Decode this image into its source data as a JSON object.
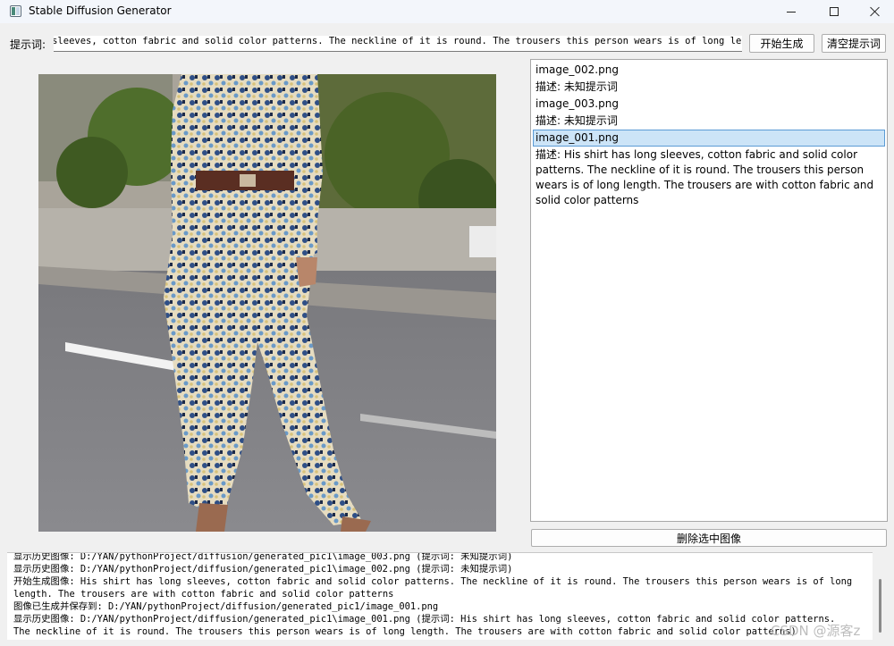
{
  "window": {
    "title": "Stable Diffusion Generator"
  },
  "prompt": {
    "label": "提示词:",
    "value": "His shirt has long sleeves, cotton fabric and solid color patterns. The neckline of it is round. The trousers this person wears is of long length. The trousers are with cotton fabric and solid color patterns"
  },
  "buttons": {
    "generate": "开始生成",
    "clear": "清空提示词",
    "delete": "删除选中图像"
  },
  "history": {
    "items": [
      {
        "text": "image_002.png",
        "selected": false
      },
      {
        "text": "描述: 未知提示词",
        "selected": false
      },
      {
        "text": "image_003.png",
        "selected": false
      },
      {
        "text": "描述: 未知提示词",
        "selected": false
      },
      {
        "text": "image_001.png",
        "selected": true
      },
      {
        "text": "描述: His shirt has long sleeves, cotton fabric and solid color patterns. The neckline of it is round. The trousers this person wears is of long length. The trousers are with cotton fabric and solid color patterns",
        "selected": false
      }
    ]
  },
  "log": {
    "lines": [
      "显示历史图像: D:/YAN/pythonProject/diffusion/generated_pic1\\image_003.png (提示词: 未知提示词)",
      "显示历史图像: D:/YAN/pythonProject/diffusion/generated_pic1\\image_002.png (提示词: 未知提示词)",
      "开始生成图像: His shirt has long sleeves, cotton fabric and solid color patterns. The neckline of it is round. The trousers this person wears is of long length. The trousers are with cotton fabric and solid color patterns",
      "图像已生成并保存到: D:/YAN/pythonProject/diffusion/generated_pic1/image_001.png",
      "显示历史图像: D:/YAN/pythonProject/diffusion/generated_pic1\\image_001.png (提示词: His shirt has long sleeves, cotton fabric and solid color patterns. The neckline of it is round. The trousers this person wears is of long length. The trousers are with cotton fabric and solid color patterns)"
    ]
  },
  "watermark": "CSDN @源客z",
  "icons": {
    "app": "app-window-icon",
    "minimize": "minimize-icon",
    "maximize": "maximize-icon",
    "close": "close-icon"
  }
}
